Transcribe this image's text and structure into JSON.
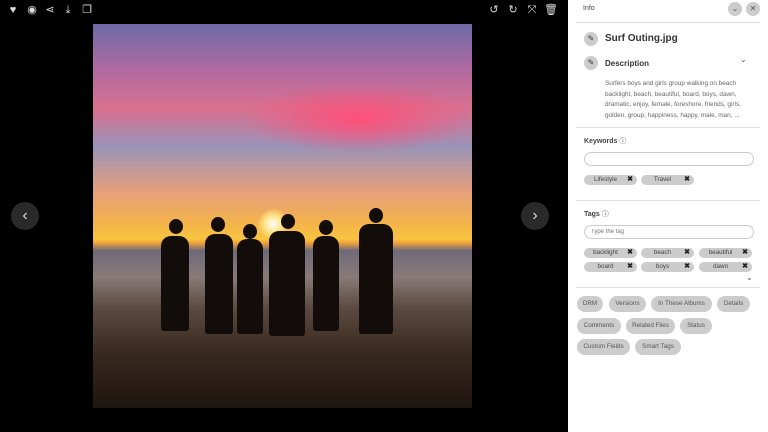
{
  "toolbar": {
    "left": [
      "heart-icon",
      "eye-icon",
      "share-icon",
      "download-icon",
      "copy-icon"
    ],
    "right": [
      "undo-icon",
      "redo-icon",
      "fit-icon",
      "trash-icon"
    ]
  },
  "panel": {
    "header": "Info",
    "file_name": "Surf Outing.jpg",
    "description_label": "Description",
    "description": "Surfers boys and girls group walking on beach backlight, beach, beautiful, board, boys, dawn, dramatic, enjoy, female, foreshore, friends, girls, golden, group, happiness, happy, male, man, ...",
    "keywords_label": "Keywords",
    "keywords_value": "",
    "keywords": [
      "Lifestyle",
      "Travel"
    ],
    "tags_label": "Tags",
    "tags_placeholder": "Type the tag",
    "tags": [
      "backlight",
      "beach",
      "beautiful",
      "board",
      "boys",
      "dawn"
    ],
    "sections": [
      "DRM",
      "Versions",
      "In These Albums",
      "Details",
      "Comments",
      "Related Files",
      "Status",
      "Custom Fields",
      "Smart Tags"
    ]
  }
}
